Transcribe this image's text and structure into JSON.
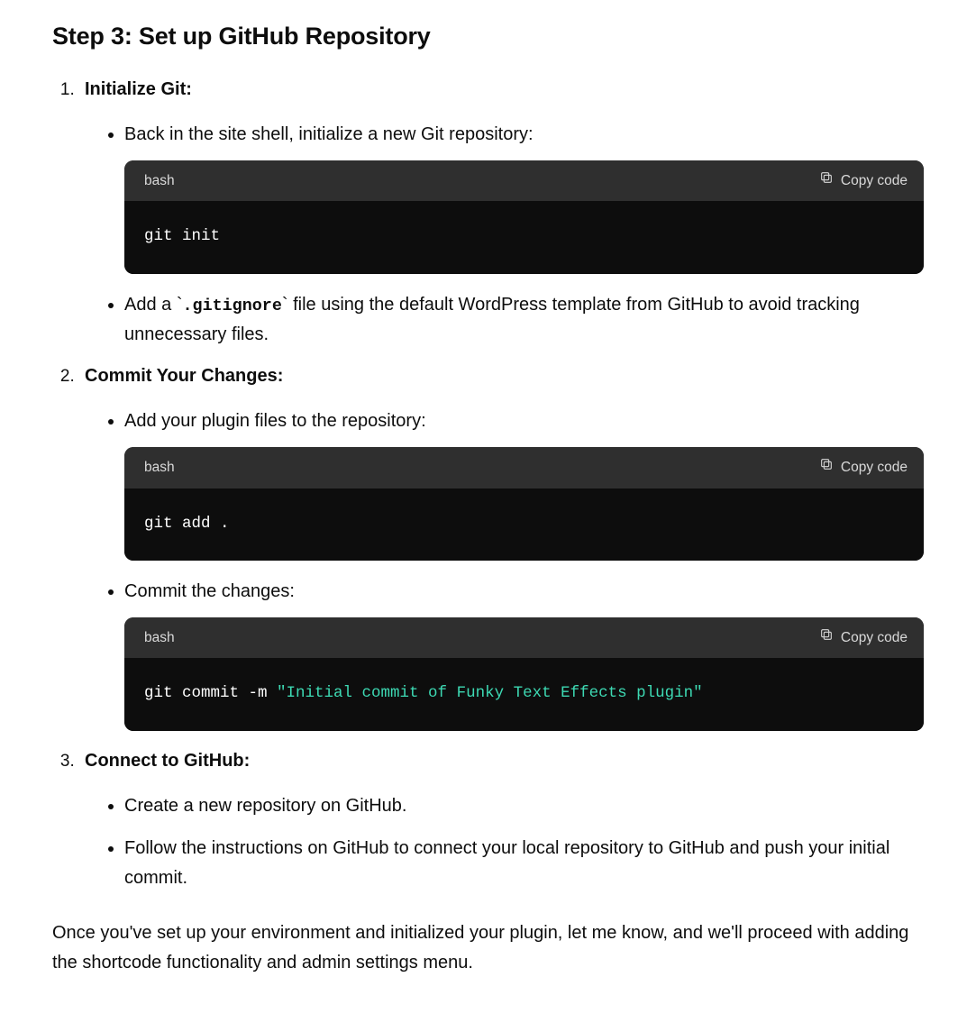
{
  "heading": "Step 3: Set up GitHub Repository",
  "copy_label": "Copy code",
  "steps": [
    {
      "title": "Initialize Git:",
      "items": [
        {
          "text": "Back in the site shell, initialize a new Git repository:",
          "code": {
            "lang": "bash",
            "plain": "git init"
          }
        },
        {
          "pre": "Add a ",
          "inline_code": ".gitignore",
          "post": " file using the default WordPress template from GitHub to avoid tracking unnecessary files."
        }
      ]
    },
    {
      "title": "Commit Your Changes:",
      "items": [
        {
          "text": "Add your plugin files to the repository:",
          "code": {
            "lang": "bash",
            "plain": "git add ."
          }
        },
        {
          "text": "Commit the changes:",
          "code": {
            "lang": "bash",
            "prefix": "git commit -m ",
            "string": "\"Initial commit of Funky Text Effects plugin\""
          }
        }
      ]
    },
    {
      "title": "Connect to GitHub:",
      "items": [
        {
          "text": "Create a new repository on GitHub."
        },
        {
          "text": "Follow the instructions on GitHub to connect your local repository to GitHub and push your initial commit."
        }
      ]
    }
  ],
  "closing": "Once you've set up your environment and initialized your plugin, let me know, and we'll proceed with adding the shortcode functionality and admin settings menu."
}
